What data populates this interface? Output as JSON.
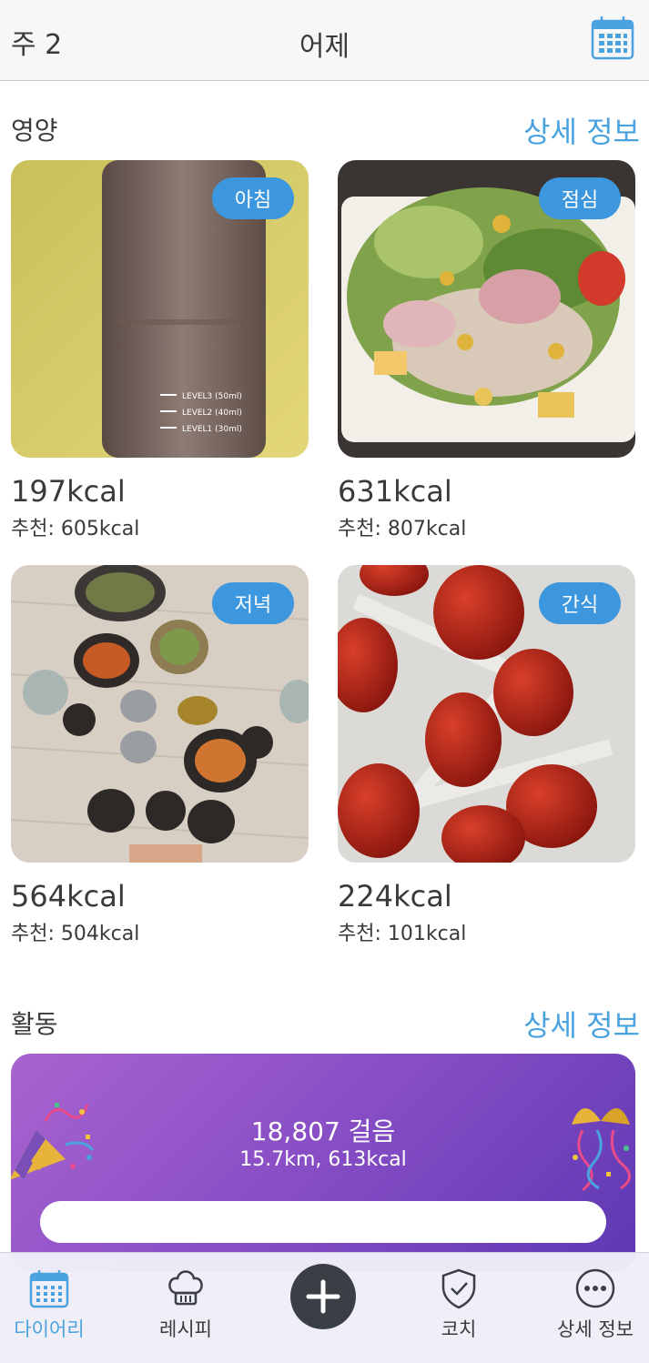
{
  "header": {
    "week_label": "주 2",
    "day_title": "어제",
    "calendar_icon": "calendar-icon"
  },
  "nutrition": {
    "title": "영양",
    "details_link": "상세 정보",
    "meals": [
      {
        "tag": "아침",
        "kcal": "197kcal",
        "recommended": "추천: 605kcal"
      },
      {
        "tag": "점심",
        "kcal": "631kcal",
        "recommended": "추천: 807kcal"
      },
      {
        "tag": "저녁",
        "kcal": "564kcal",
        "recommended": "추천: 504kcal"
      },
      {
        "tag": "간식",
        "kcal": "224kcal",
        "recommended": "추천: 101kcal"
      }
    ],
    "bottle_labels": [
      "LEVEL3 (50ml)",
      "LEVEL2 (40ml)",
      "LEVEL1 (30ml)"
    ]
  },
  "activity": {
    "title": "활동",
    "details_link": "상세 정보",
    "steps": "18,807 걸음",
    "distance": "15.7km, 613kcal",
    "icons": [
      "party-popper-icon",
      "confetti-ball-icon"
    ]
  },
  "tabbar": {
    "tabs": [
      {
        "label": "다이어리",
        "icon": "calendar-icon",
        "active": true
      },
      {
        "label": "레시피",
        "icon": "chef-hat-icon",
        "active": false
      },
      {
        "label": "",
        "icon": "plus-icon",
        "active": false
      },
      {
        "label": "코치",
        "icon": "shield-check-icon",
        "active": false
      },
      {
        "label": "상세 정보",
        "icon": "more-icon",
        "active": false
      }
    ]
  },
  "colors": {
    "accent": "#4aa3df",
    "badge": "#3d97de",
    "activity_gradient_start": "#a864cf",
    "activity_gradient_end": "#5c38b3",
    "add_button": "#3a3f45"
  }
}
